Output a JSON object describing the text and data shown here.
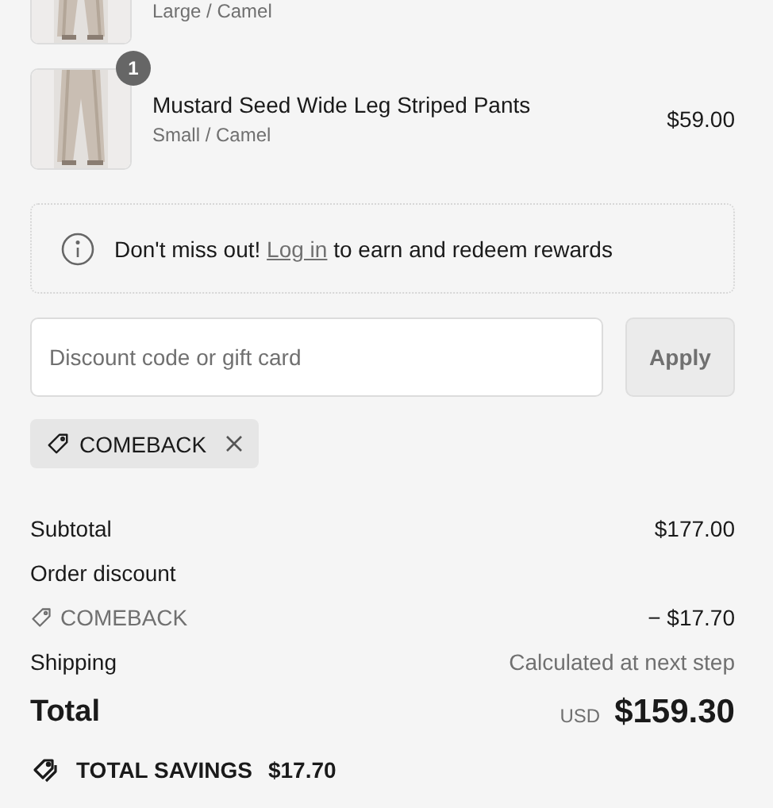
{
  "items": [
    {
      "variant": "Large / Camel"
    },
    {
      "quantity": "1",
      "title": "Mustard Seed Wide Leg Striped Pants",
      "variant": "Small / Camel",
      "price": "$59.00"
    }
  ],
  "notice": {
    "before": "Don't miss out!",
    "link": "Log in",
    "after": "to earn and redeem rewards"
  },
  "discount": {
    "placeholder": "Discount code or gift card",
    "button": "Apply"
  },
  "applied_codes": [
    {
      "code": "COMEBACK"
    }
  ],
  "summary": [
    {
      "kind": "row",
      "label": "Subtotal",
      "value": "$177.00"
    },
    {
      "kind": "row",
      "label": "Order discount"
    },
    {
      "kind": "code",
      "label": "COMEBACK",
      "value": "− $17.70"
    },
    {
      "kind": "note",
      "label": "Shipping",
      "value": "Calculated at next step"
    }
  ],
  "total": {
    "label": "Total",
    "currency": "USD",
    "amount": "$159.30"
  },
  "savings": {
    "label": "TOTAL SAVINGS",
    "amount": "$17.70"
  }
}
